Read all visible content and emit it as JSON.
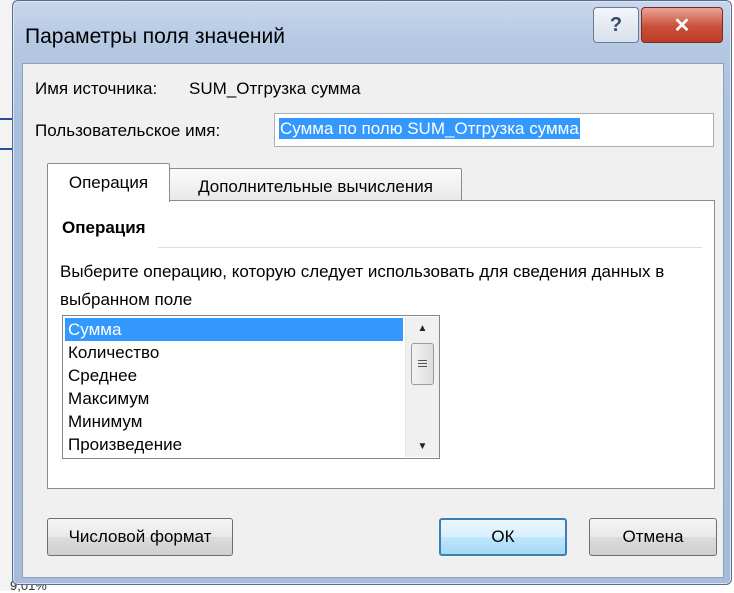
{
  "window": {
    "title": "Параметры поля значений",
    "help_glyph": "?",
    "close_glyph": "✕"
  },
  "source": {
    "label": "Имя источника:",
    "value": "SUM_Отгрузка сумма"
  },
  "custom_name": {
    "label": "Пользовательское имя:",
    "value": "Сумма по полю SUM_Отгрузка сумма"
  },
  "tabs": [
    {
      "label": "Операция",
      "active": true
    },
    {
      "label": "Дополнительные вычисления",
      "active": false
    }
  ],
  "operation": {
    "heading": "Операция",
    "description": "Выберите операцию, которую следует использовать для сведения данных в выбранном поле",
    "items": [
      "Сумма",
      "Количество",
      "Среднее",
      "Максимум",
      "Минимум",
      "Произведение"
    ],
    "selected": "Сумма"
  },
  "buttons": {
    "number_format": "Числовой формат",
    "ok": "ОК",
    "cancel": "Отмена"
  },
  "background": {
    "bottom_text": "9,01%"
  },
  "colors": {
    "selection": "#3399ff",
    "close_button": "#c9503a",
    "frame": "#b6c9e3"
  }
}
